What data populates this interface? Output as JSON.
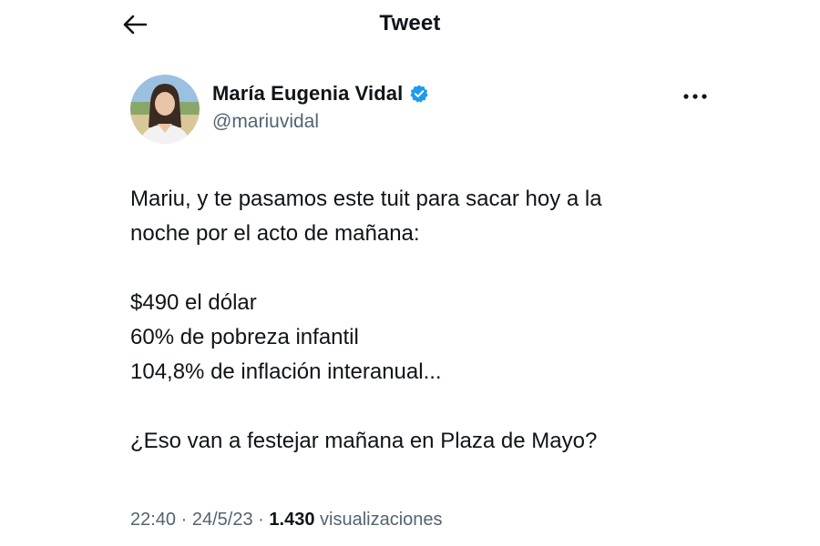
{
  "header": {
    "title": "Tweet",
    "back_icon": "arrow-left-icon"
  },
  "author": {
    "display_name": "María Eugenia Vidal",
    "handle": "@mariuvidal",
    "verified_icon": "verified-badge-icon",
    "verified_color": "#1d9bf0",
    "more_icon": "more-horizontal-icon"
  },
  "tweet": {
    "lines": [
      "Mariu, y te pasamos este tuit para sacar hoy a la",
      "noche por el acto de mañana:",
      "",
      "$490 el dólar",
      "60% de pobreza infantil",
      "104,8% de inflación interanual...",
      "",
      "¿Eso van a festejar mañana en Plaza de Mayo?"
    ]
  },
  "meta": {
    "time": "22:40",
    "date": "24/5/23",
    "separator": "·",
    "views_count": "1.430",
    "views_label": "visualizaciones"
  },
  "colors": {
    "text_primary": "#0f1419",
    "text_secondary": "#536471",
    "background": "#ffffff"
  }
}
